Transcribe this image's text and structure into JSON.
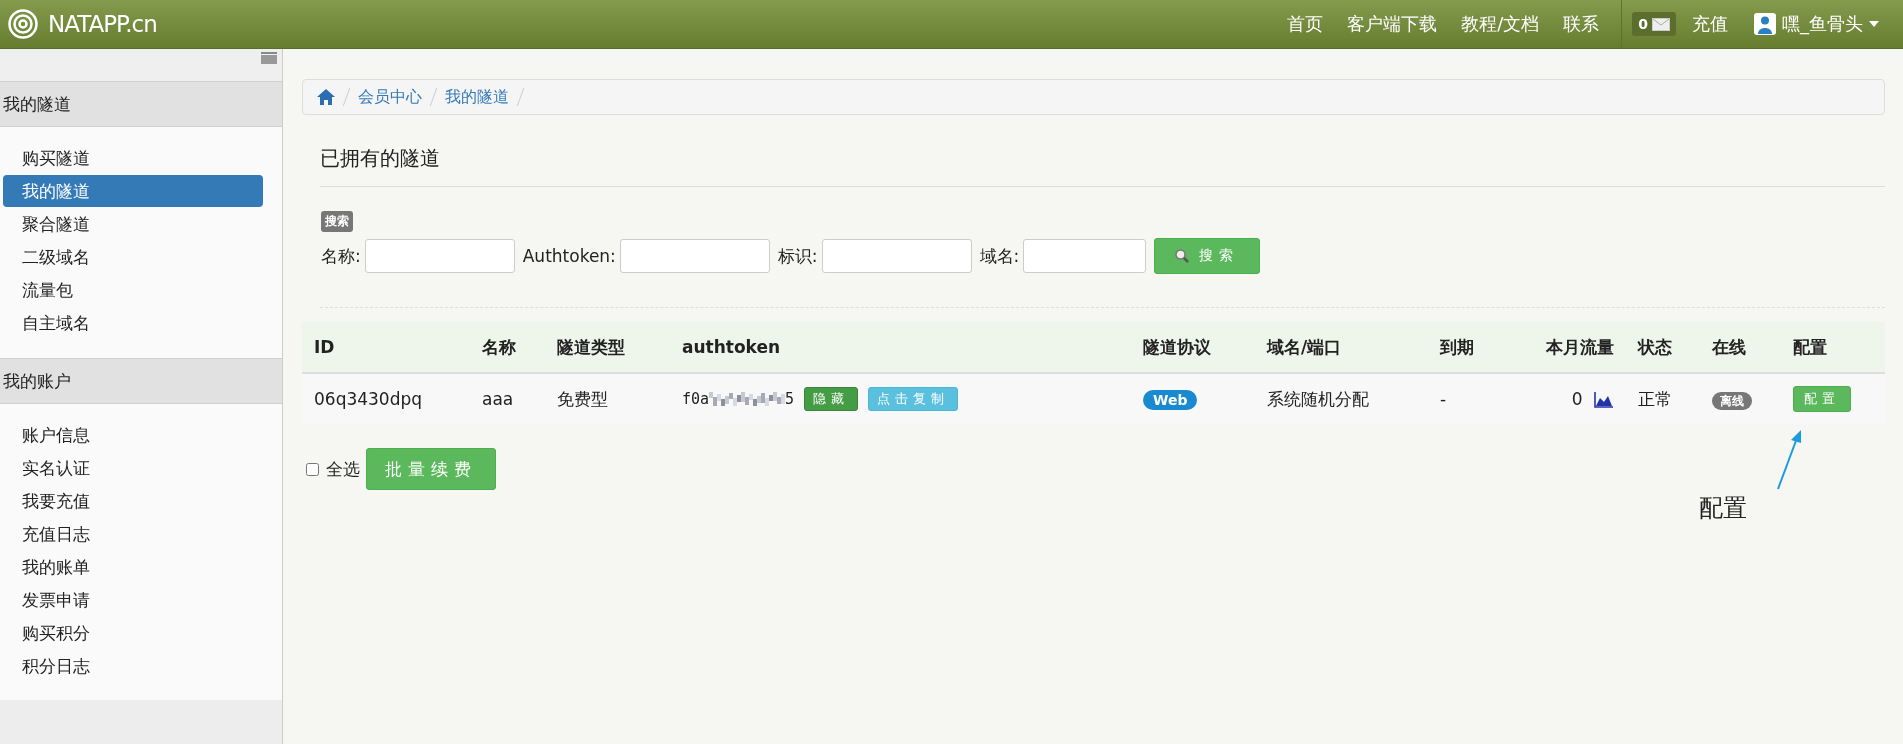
{
  "navbar": {
    "brand": "NATAPP.cn",
    "links": [
      "首页",
      "客户端下载",
      "教程/文档",
      "联系"
    ],
    "message_count": "0",
    "recharge": "充值",
    "user": "嘿_鱼骨头"
  },
  "sidebar": {
    "sections": [
      {
        "title": "我的隧道",
        "items": [
          {
            "label": "购买隧道",
            "selected": false
          },
          {
            "label": "我的隧道",
            "selected": true
          },
          {
            "label": "聚合隧道",
            "selected": false
          },
          {
            "label": "二级域名",
            "selected": false
          },
          {
            "label": "流量包",
            "selected": false
          },
          {
            "label": "自主域名",
            "selected": false
          }
        ]
      },
      {
        "title": "我的账户",
        "items": [
          {
            "label": "账户信息",
            "selected": false
          },
          {
            "label": "实名认证",
            "selected": false
          },
          {
            "label": "我要充值",
            "selected": false
          },
          {
            "label": "充值日志",
            "selected": false
          },
          {
            "label": "我的账单",
            "selected": false
          },
          {
            "label": "发票申请",
            "selected": false
          },
          {
            "label": "购买积分",
            "selected": false
          },
          {
            "label": "积分日志",
            "selected": false
          }
        ]
      }
    ]
  },
  "breadcrumb": [
    "会员中心",
    "我的隧道"
  ],
  "page_title": "已拥有的隧道",
  "search": {
    "badge": "搜索",
    "fields": [
      {
        "label": "名称:"
      },
      {
        "label": "Authtoken:"
      },
      {
        "label": "标识:"
      },
      {
        "label": "域名:"
      }
    ],
    "button": "搜索"
  },
  "table": {
    "columns": [
      "ID",
      "名称",
      "隧道类型",
      "authtoken",
      "隧道协议",
      "域名/端口",
      "到期",
      "本月流量",
      "状态",
      "在线",
      "配置"
    ],
    "rows": [
      {
        "id": "06q3430dpq",
        "name": "aaa",
        "type": "免费型",
        "authtoken_prefix": "f0a",
        "authtoken_suffix": "5",
        "hide_button": "隐藏",
        "copy_button": "点击复制",
        "protocol": "Web",
        "domain": "系统随机分配",
        "expiry": "-",
        "traffic": "0",
        "status": "正常",
        "online": "离线",
        "config_button": "配置"
      }
    ]
  },
  "select_all": {
    "label": "全选",
    "checked": false
  },
  "renew_button": "批量续费",
  "annotation": "配置"
}
